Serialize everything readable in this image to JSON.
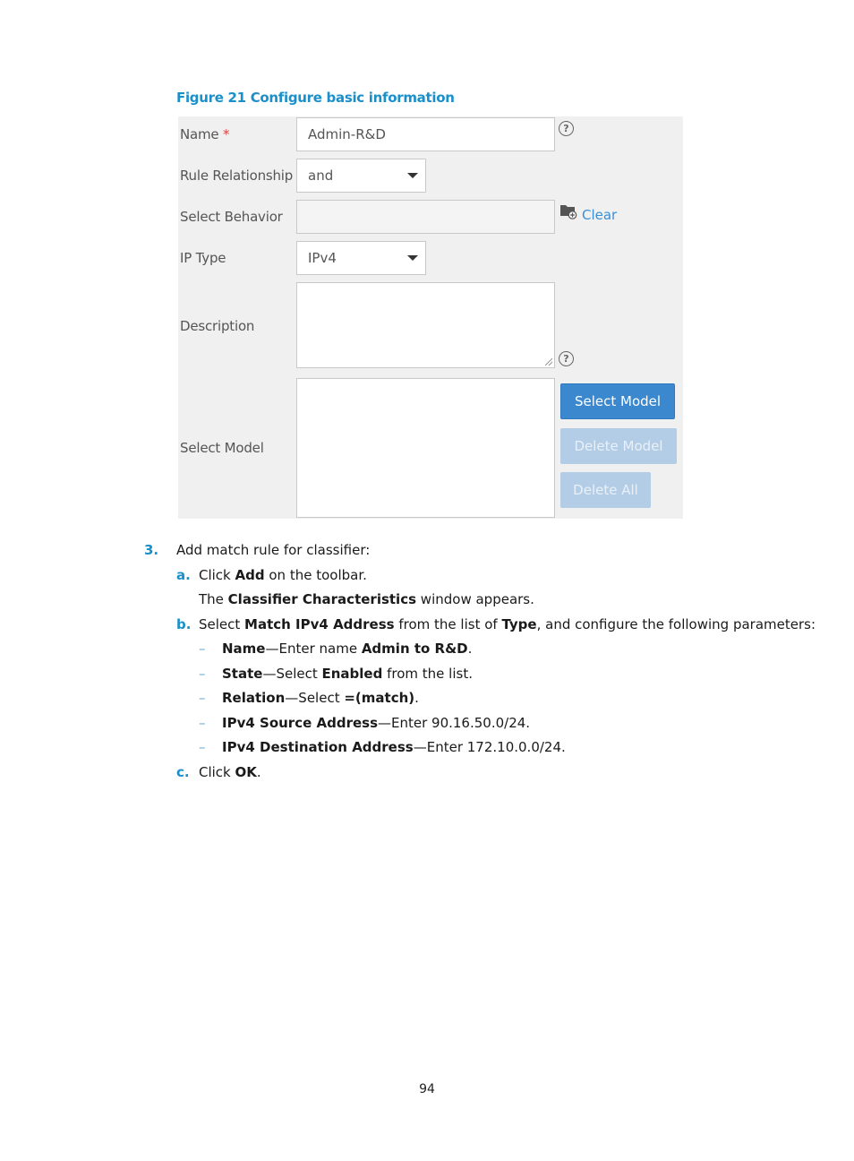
{
  "caption": "Figure 21 Configure basic information",
  "form": {
    "name_label": "Name",
    "required_mark": "*",
    "name_value": "Admin-R&D",
    "rule_relationship_label": "Rule Relationship",
    "rule_relationship_value": "and",
    "select_behavior_label": "Select Behavior",
    "select_behavior_value": "",
    "clear_label": "Clear",
    "ip_type_label": "IP Type",
    "ip_type_value": "IPv4",
    "description_label": "Description",
    "description_value": "",
    "select_model_label": "Select Model",
    "help_glyph": "?",
    "buttons": {
      "select_model": "Select Model",
      "delete_model": "Delete Model",
      "delete_all": "Delete All"
    }
  },
  "steps": {
    "step3": {
      "num": "3.",
      "text": "Add match rule for classifier:"
    },
    "a": {
      "num": "a.",
      "pre": "Click ",
      "bold": "Add",
      "post": " on the toolbar."
    },
    "a_note": {
      "pre": "The ",
      "bold": "Classifier Characteristics",
      "post": " window appears."
    },
    "b": {
      "num": "b.",
      "pre": "Select ",
      "bold1": "Match IPv4 Address",
      "mid": " from the list of ",
      "bold2": "Type",
      "post": ", and configure the following parameters:"
    },
    "params": [
      {
        "bold": "Name",
        "text": "—Enter name ",
        "bold2": "Admin to R&D",
        "post": "."
      },
      {
        "bold": "State",
        "text": "—Select ",
        "bold2": "Enabled",
        "post": " from the list."
      },
      {
        "bold": "Relation",
        "text": "—Select ",
        "bold2": "=(match)",
        "post": "."
      },
      {
        "bold": "IPv4 Source Address",
        "text": "—Enter 90.16.50.0/24.",
        "bold2": "",
        "post": ""
      },
      {
        "bold": "IPv4 Destination Address",
        "text": "—Enter 172.10.0.0/24.",
        "bold2": "",
        "post": ""
      }
    ],
    "dash": "–",
    "c": {
      "num": "c.",
      "pre": "Click ",
      "bold": "OK",
      "post": "."
    }
  },
  "page_number": "94"
}
